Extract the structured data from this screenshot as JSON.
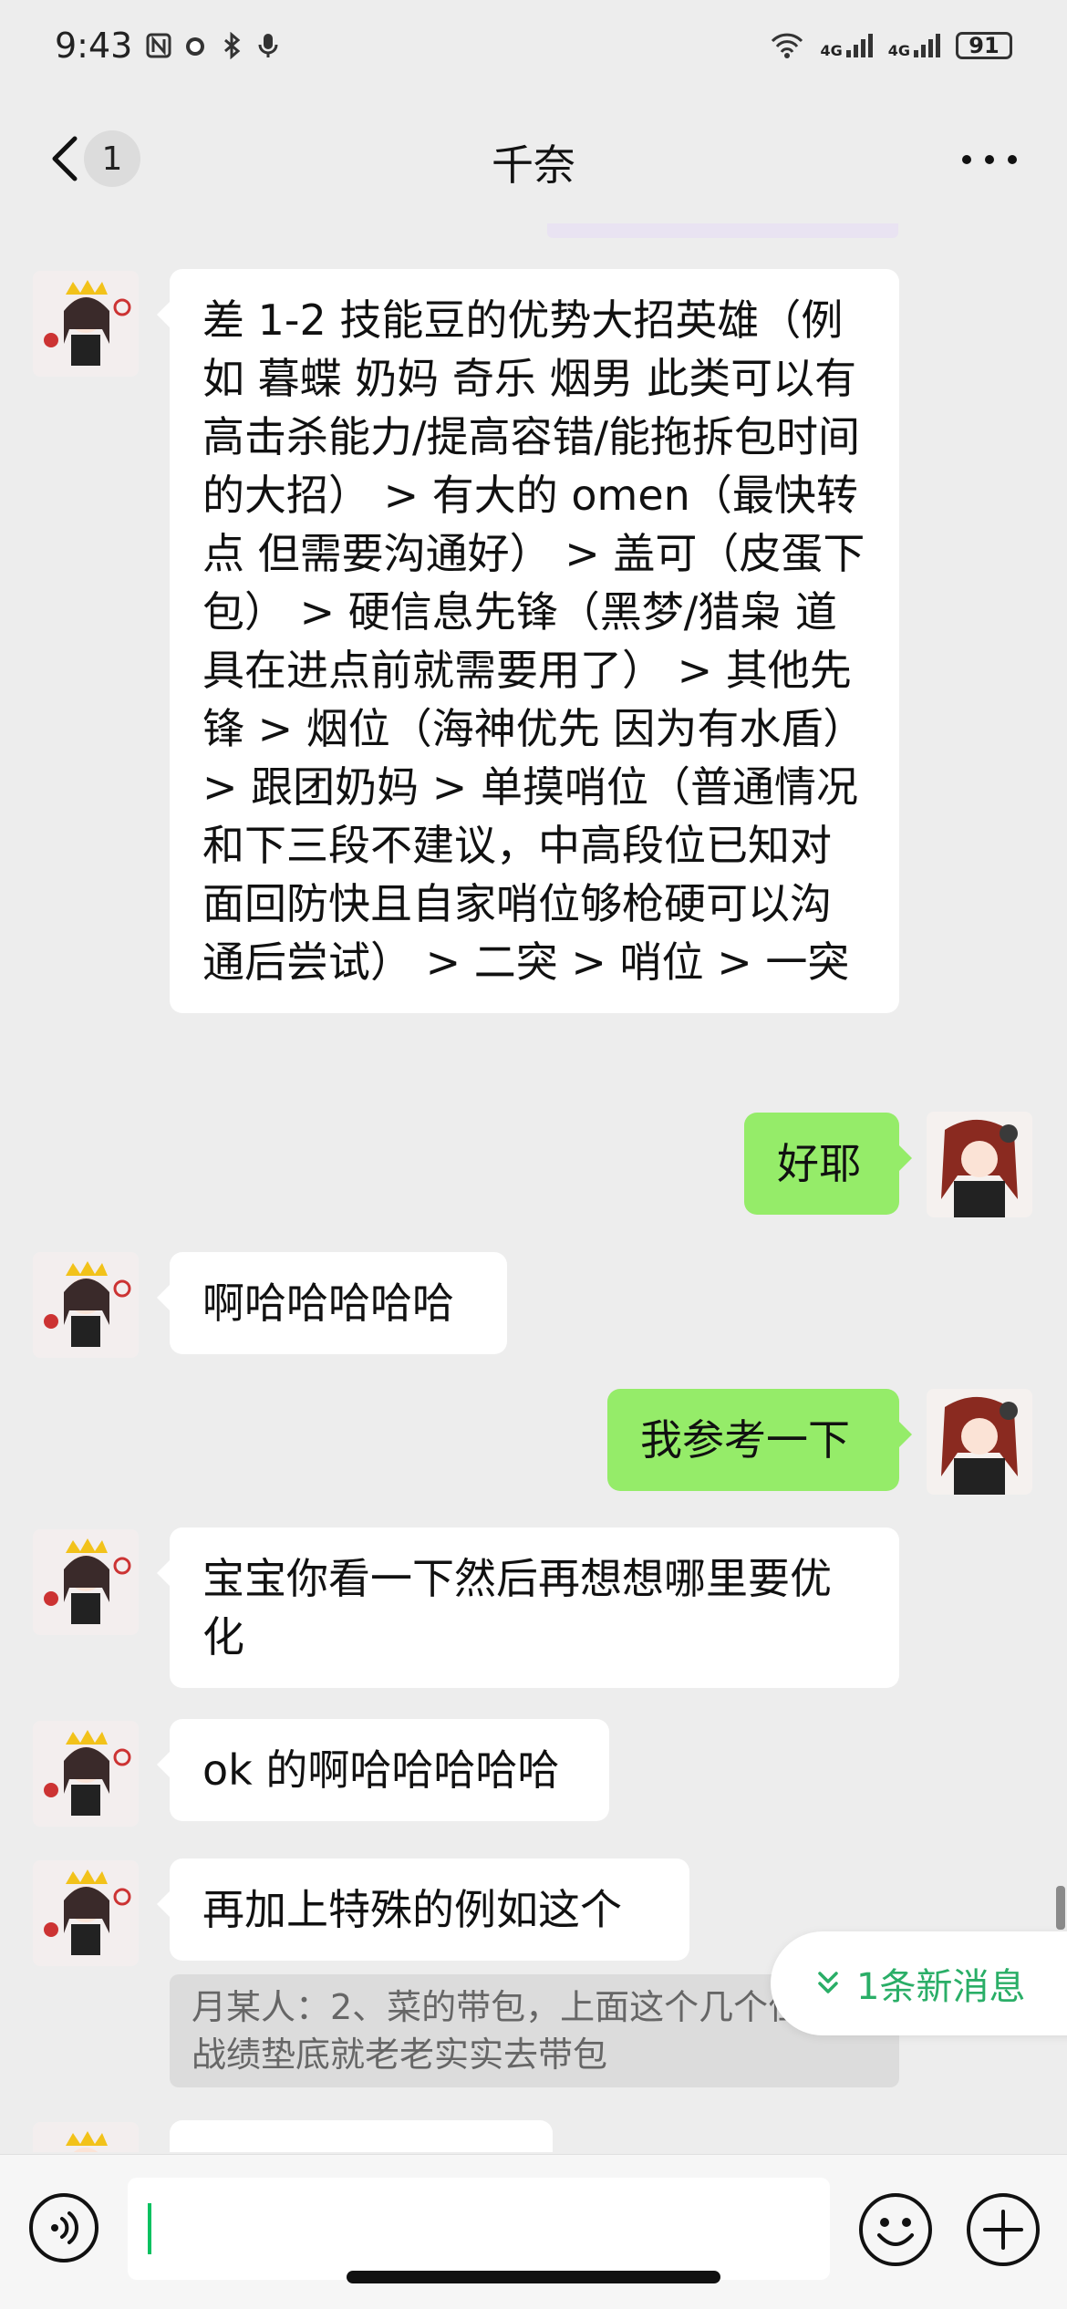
{
  "status_bar": {
    "time": "9:43",
    "battery": "91",
    "network_a": "4G",
    "network_b": "4G"
  },
  "nav": {
    "back_badge": "1",
    "title": "千奈"
  },
  "messages": [
    {
      "side": "in",
      "text": "差 1-2 技能豆的优势大招英雄（例如 暮蝶 奶妈 奇乐 烟男 此类可以有高击杀能力/提高容错/能拖拆包时间的大招） > 有大的 omen（最快转点 但需要沟通好） > 盖可（皮蛋下包） > 硬信息先锋（黑梦/猎枭 道具在进点前就需要用了） > 其他先锋 > 烟位（海神优先 因为有水盾） > 跟团奶妈 > 单摸哨位（普通情况和下三段不建议，中高段位已知对面回防快且自家哨位够枪硬可以沟通后尝试） > 二突 > 哨位 > 一突"
    },
    {
      "side": "out",
      "text": "好耶"
    },
    {
      "side": "in",
      "text": "啊哈哈哈哈哈"
    },
    {
      "side": "out",
      "text": "我参考一下"
    },
    {
      "side": "in",
      "text": "宝宝你看一下然后再想想哪里要优化"
    },
    {
      "side": "in",
      "text": "ok 的啊哈哈哈哈哈"
    },
    {
      "side": "in",
      "text": "再加上特殊的例如这个"
    }
  ],
  "quote": {
    "text": "月某人：2、菜的带包，上面这个几个位置，战绩垫底就老老实实去带包"
  },
  "new_message_pill": {
    "label": "1条新消息"
  },
  "colors": {
    "outgoing_bubble": "#95ec69",
    "incoming_bubble": "#ffffff",
    "background": "#ededed",
    "accent_green": "#2aae67"
  },
  "icons": {
    "back": "chevron-left-icon",
    "more": "more-dots-icon",
    "voice": "voice-icon",
    "emoji": "emoji-icon",
    "plus": "plus-icon"
  }
}
